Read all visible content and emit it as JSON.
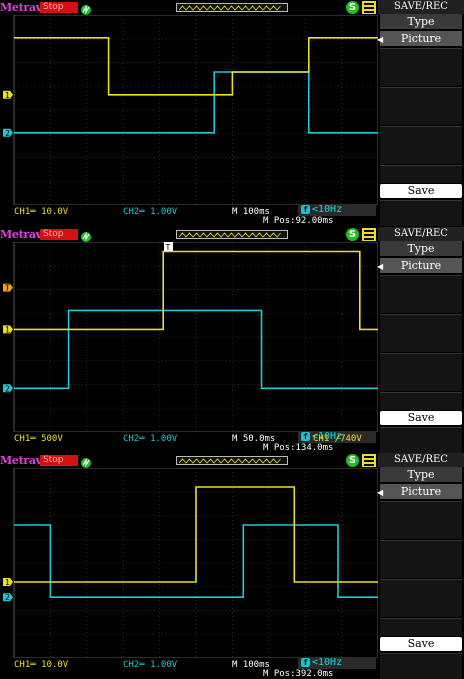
{
  "colors": {
    "ch1": "#e8e020",
    "ch2": "#20c8d8",
    "brand": "#e040e0",
    "stop": "#d41010",
    "grid": "#3a3a3a"
  },
  "panels": [
    {
      "brand": "Metravi",
      "status": "Stop",
      "menu_title": "SAVE/REC",
      "menu_type_label": "Type",
      "menu_type_value": "Picture",
      "save_label": "Save",
      "freq": "<10Hz",
      "ch1_scale": "CH1═ 10.0V",
      "ch2_scale": "CH2═ 1.00V",
      "timebase": "M 100ms",
      "mpos": "M Pos:92.00ms",
      "trigger_readout": "",
      "ch1_trace": [
        [
          0,
          0.12
        ],
        [
          0.26,
          0.12
        ],
        [
          0.26,
          0.42
        ],
        [
          0.6,
          0.42
        ],
        [
          0.6,
          0.3
        ],
        [
          0.81,
          0.3
        ],
        [
          0.81,
          0.12
        ],
        [
          1,
          0.12
        ]
      ],
      "ch2_trace": [
        [
          0,
          0.62
        ],
        [
          0.55,
          0.62
        ],
        [
          0.55,
          0.3
        ],
        [
          0.81,
          0.3
        ],
        [
          0.81,
          0.62
        ],
        [
          1,
          0.62
        ]
      ],
      "ch1_marker": 0.42,
      "ch2_marker": 0.62,
      "trigger_marker": null
    },
    {
      "brand": "Metravi",
      "status": "Stop",
      "menu_title": "SAVE/REC",
      "menu_type_label": "Type",
      "menu_type_value": "Picture",
      "save_label": "Save",
      "freq": "<10Hz",
      "ch1_scale": "CH1═ 500V",
      "ch2_scale": "CH2═ 1.00V",
      "timebase": "M 50.0ms",
      "mpos": "M Pos:134.0ms",
      "trigger_readout": "CH1 /740V",
      "ch1_trace": [
        [
          0,
          0.46
        ],
        [
          0.41,
          0.46
        ],
        [
          0.41,
          0.05
        ],
        [
          0.95,
          0.05
        ],
        [
          0.95,
          0.46
        ],
        [
          1,
          0.46
        ]
      ],
      "ch2_trace": [
        [
          0,
          0.77
        ],
        [
          0.15,
          0.77
        ],
        [
          0.15,
          0.36
        ],
        [
          0.68,
          0.36
        ],
        [
          0.68,
          0.77
        ],
        [
          1,
          0.77
        ]
      ],
      "ch1_marker": 0.46,
      "ch2_marker": 0.77,
      "trigger_marker": 0.24
    },
    {
      "brand": "Metravi",
      "status": "Stop",
      "menu_title": "SAVE/REC",
      "menu_type_label": "Type",
      "menu_type_value": "Picture",
      "save_label": "Save",
      "freq": "<10Hz",
      "ch1_scale": "CH1═ 10.0V",
      "ch2_scale": "CH2═ 1.00V",
      "timebase": "M 100ms",
      "mpos": "M Pos:392.0ms",
      "trigger_readout": "",
      "ch1_trace": [
        [
          0,
          0.6
        ],
        [
          0.5,
          0.6
        ],
        [
          0.5,
          0.1
        ],
        [
          0.77,
          0.1
        ],
        [
          0.77,
          0.6
        ],
        [
          1,
          0.6
        ]
      ],
      "ch2_trace": [
        [
          0,
          0.3
        ],
        [
          0.1,
          0.3
        ],
        [
          0.1,
          0.68
        ],
        [
          0.63,
          0.68
        ],
        [
          0.63,
          0.3
        ],
        [
          0.89,
          0.3
        ],
        [
          0.89,
          0.68
        ],
        [
          1,
          0.68
        ]
      ],
      "ch1_marker": 0.6,
      "ch2_marker": 0.68,
      "trigger_marker": null
    }
  ]
}
